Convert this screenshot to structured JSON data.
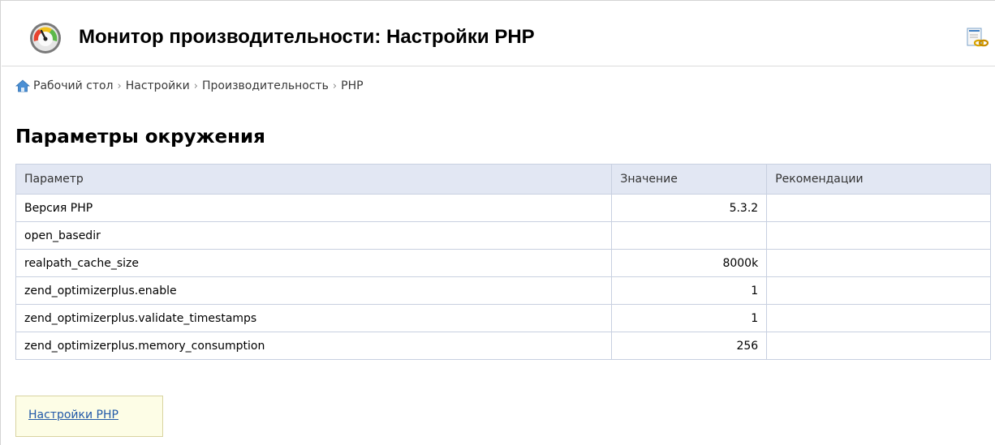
{
  "header": {
    "title": "Монитор производительности: Настройки PHP"
  },
  "breadcrumb": [
    "Рабочий стол",
    "Настройки",
    "Производительность",
    "PHP"
  ],
  "section": {
    "title": "Параметры окружения"
  },
  "table": {
    "headers": [
      "Параметр",
      "Значение",
      "Рекомендации"
    ],
    "rows": [
      {
        "param": "Версия PHP",
        "value": "5.3.2",
        "recommendation": ""
      },
      {
        "param": "open_basedir",
        "value": "",
        "recommendation": ""
      },
      {
        "param": "realpath_cache_size",
        "value": "8000k",
        "recommendation": ""
      },
      {
        "param": "zend_optimizerplus.enable",
        "value": "1",
        "recommendation": ""
      },
      {
        "param": "zend_optimizerplus.validate_timestamps",
        "value": "1",
        "recommendation": ""
      },
      {
        "param": "zend_optimizerplus.memory_consumption",
        "value": "256",
        "recommendation": ""
      }
    ]
  },
  "footer_link": {
    "label": "Настройки PHP"
  },
  "icons": {
    "app": "performance-gauge-icon",
    "link": "hyperlink-icon",
    "home": "home-icon"
  },
  "colors": {
    "table_header_bg": "#e2e7f3",
    "link": "#2159a8",
    "note_box_bg": "#fdfde6"
  }
}
